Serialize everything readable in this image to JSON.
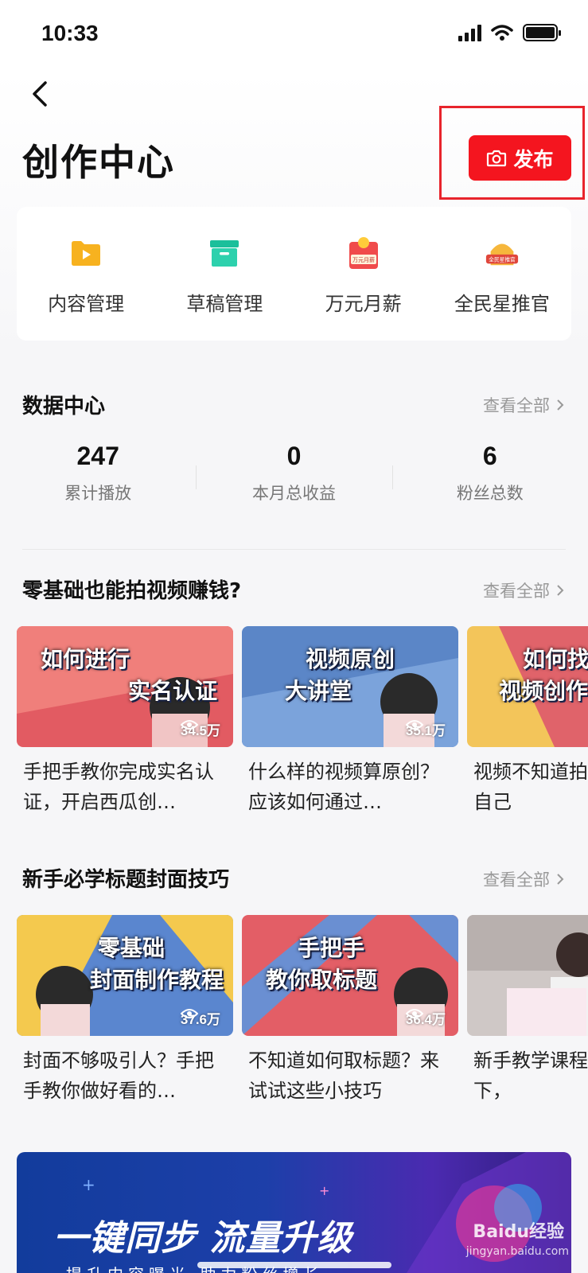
{
  "status_bar": {
    "time": "10:33"
  },
  "header": {
    "title": "创作中心",
    "publish_label": "发布"
  },
  "tools": [
    {
      "label": "内容管理",
      "icon": "folder-play-icon"
    },
    {
      "label": "草稿管理",
      "icon": "archive-box-icon"
    },
    {
      "label": "万元月薪",
      "icon": "salary-badge-icon",
      "badge_text": "万元月薪"
    },
    {
      "label": "全民星推官",
      "icon": "star-promoter-badge-icon",
      "badge_text": "全民星推官"
    }
  ],
  "data_center": {
    "title": "数据中心",
    "view_all": "查看全部",
    "stats": [
      {
        "value": "247",
        "label": "累计播放"
      },
      {
        "value": "0",
        "label": "本月总收益"
      },
      {
        "value": "6",
        "label": "粉丝总数"
      }
    ]
  },
  "section_earn": {
    "title": "零基础也能拍视频赚钱?",
    "view_all": "查看全部",
    "videos": [
      {
        "thumb_text_1": "如何进行",
        "thumb_text_2": "实名认证",
        "views": "34.5万",
        "title": "手把手教你完成实名认证，开启西瓜创…"
      },
      {
        "thumb_text_1": "视频原创",
        "thumb_text_2": "大讲堂",
        "views": "35.1万",
        "title": "什么样的视频算原创？应该如何通过…"
      },
      {
        "thumb_text_1": "如何找",
        "thumb_text_2": "视频创作",
        "views": "",
        "title": "视频不知道拍带你找到自己"
      }
    ]
  },
  "section_cover": {
    "title": "新手必学标题封面技巧",
    "view_all": "查看全部",
    "videos": [
      {
        "thumb_text_1": "零基础",
        "thumb_text_2": "封面制作教程",
        "views": "37.6万",
        "title": "封面不够吸引人？手把手教你做好看的…"
      },
      {
        "thumb_text_1": "手把手",
        "thumb_text_2": "教你取标题",
        "views": "36.4万",
        "title": "不知道如何取标题？来试试这些小技巧"
      },
      {
        "thumb_text_1": "",
        "thumb_text_2": "",
        "views": "",
        "title": "新手教学课程避雷指南下，"
      }
    ]
  },
  "banner": {
    "title": "一键同步 流量升级",
    "subtitle": "提升内容曝光 助力粉丝增长"
  },
  "watermark": {
    "brand": "Baidu经验",
    "url": "jingyan.baidu.com"
  },
  "colors": {
    "accent": "#f4151f",
    "highlight_box": "#e8242c"
  }
}
